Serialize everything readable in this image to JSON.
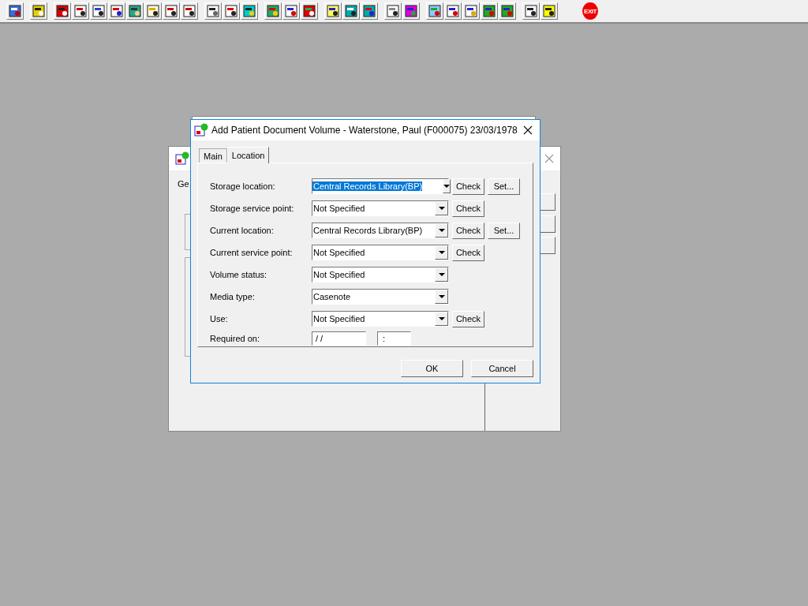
{
  "toolbar": {
    "exit_label": "EXIT"
  },
  "background_window": {
    "tab_label": "Ge"
  },
  "dialog": {
    "title": "Add Patient Document Volume - Waterstone, Paul (F000075) 23/03/1978",
    "tabs": [
      {
        "label": "Main",
        "selected": false
      },
      {
        "label": "Location",
        "selected": true
      }
    ],
    "fields": [
      {
        "kind": "combo",
        "label": "Storage location:",
        "value": "Central Records Library(BP)",
        "highlighted": true,
        "buttons": [
          "Check",
          "Set..."
        ]
      },
      {
        "kind": "combo",
        "label": "Storage service point:",
        "value": "Not Specified",
        "highlighted": false,
        "buttons": [
          "Check"
        ]
      },
      {
        "kind": "combo",
        "label": "Current location:",
        "value": "Central Records Library(BP)",
        "highlighted": false,
        "buttons": [
          "Check",
          "Set..."
        ]
      },
      {
        "kind": "combo",
        "label": "Current service point:",
        "value": "Not Specified",
        "highlighted": false,
        "buttons": [
          "Check"
        ]
      },
      {
        "kind": "combo",
        "label": "Volume status:",
        "value": "Not Specified",
        "highlighted": false
      },
      {
        "kind": "combo",
        "label": "Media type:",
        "value": "Casenote",
        "highlighted": false
      },
      {
        "kind": "combo",
        "label": "Use:",
        "value": "Not Specified",
        "highlighted": false,
        "buttons": [
          "Check"
        ]
      },
      {
        "kind": "datetime",
        "label": "Required on:",
        "date": "/ /",
        "time": ":"
      }
    ],
    "buttons": [
      "OK",
      "Cancel"
    ]
  }
}
